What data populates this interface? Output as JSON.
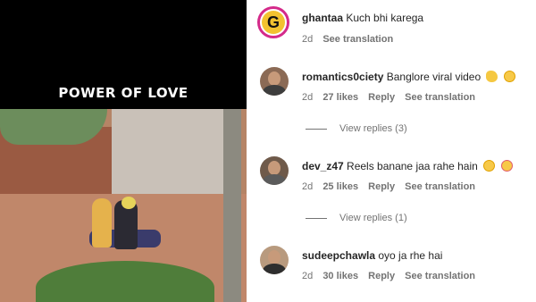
{
  "media": {
    "caption": "POWER OF LOVE"
  },
  "comments": [
    {
      "username": "ghantaa",
      "text": "Kuch bhi karega",
      "time": "2d",
      "actions": {
        "see_translation": "See translation"
      },
      "avatar_icon": "ghantaa-logo-icon"
    },
    {
      "username": "romantics0ciety",
      "text": "Banglore viral video",
      "emojis": [
        "clapping-hands-emoji",
        "laughing-face-emoji"
      ],
      "time": "2d",
      "likes": "27 likes",
      "actions": {
        "reply": "Reply",
        "see_translation": "See translation"
      },
      "view_replies": "View replies (3)"
    },
    {
      "username": "dev_z47",
      "text": "Reels banane jaa rahe hain",
      "emojis": [
        "laughing-face-emoji",
        "heart-eyes-emoji"
      ],
      "time": "2d",
      "likes": "25 likes",
      "actions": {
        "reply": "Reply",
        "see_translation": "See translation"
      },
      "view_replies": "View replies (1)"
    },
    {
      "username": "sudeepchawla",
      "text": "oyo ja rhe hai",
      "time": "2d",
      "likes": "30 likes",
      "actions": {
        "reply": "Reply",
        "see_translation": "See translation"
      }
    }
  ],
  "colors": {
    "text_primary": "#262626",
    "text_secondary": "#737373",
    "brand_ring": "#d42a8a",
    "brand_fill": "#f2c230"
  }
}
